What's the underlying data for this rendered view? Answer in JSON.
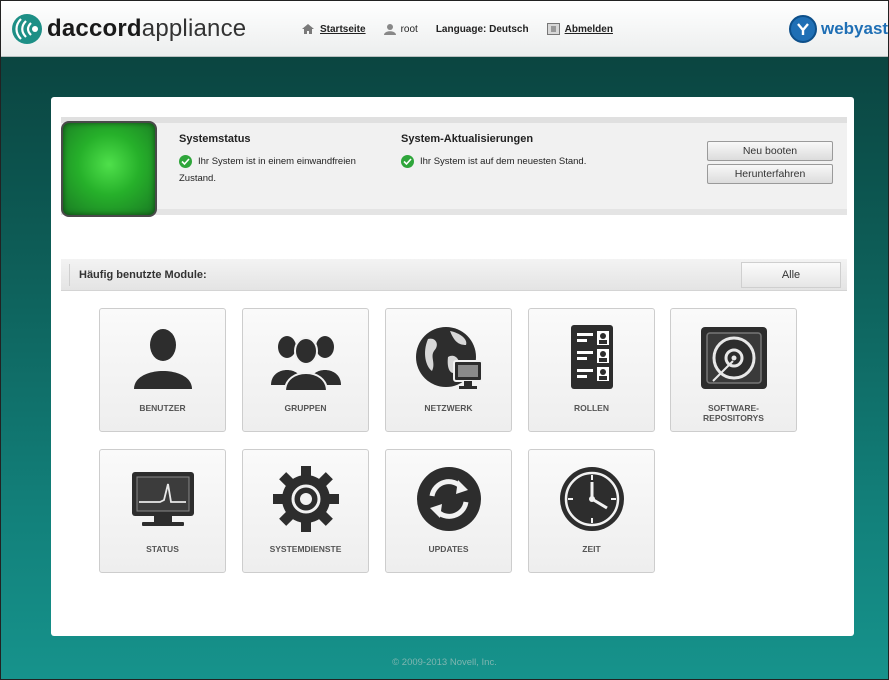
{
  "header": {
    "logo_bold": "daccord",
    "logo_light": "appliance",
    "nav": {
      "home_label": "Startseite",
      "user_label": "root",
      "language_label": "Language: Deutsch",
      "logout_label": "Abmelden"
    },
    "brand_blue": "webyast",
    "brand_green": ""
  },
  "status": {
    "system_title": "Systemstatus",
    "system_text_line1": "Ihr System ist in einem einwandfreien",
    "system_text_line2": "Zustand.",
    "updates_title": "System-Aktualisierungen",
    "updates_text": "Ihr System ist auf dem neuesten Stand.",
    "reboot_button": "Neu booten",
    "shutdown_button": "Herunterfahren",
    "indicator_color": "#2fbf34"
  },
  "modules": {
    "bar_label": "Häufig benutzte Module:",
    "all_button": "Alle",
    "tiles": [
      {
        "label": "BENUTZER",
        "icon": "user-icon"
      },
      {
        "label": "GRUPPEN",
        "icon": "group-icon"
      },
      {
        "label": "NETZWERK",
        "icon": "network-globe-icon"
      },
      {
        "label": "ROLLEN",
        "icon": "roles-icon"
      },
      {
        "label_line1": "SOFTWARE-",
        "label_line2": "REPOSITORYS",
        "icon": "disk-icon"
      },
      {
        "label": "STATUS",
        "icon": "monitor-icon"
      },
      {
        "label": "SYSTEMDIENSTE",
        "icon": "gear-icon"
      },
      {
        "label": "UPDATES",
        "icon": "refresh-icon"
      },
      {
        "label": "ZEIT",
        "icon": "clock-icon"
      }
    ]
  },
  "footer": {
    "copyright": "© 2009-2013 Novell, Inc."
  }
}
